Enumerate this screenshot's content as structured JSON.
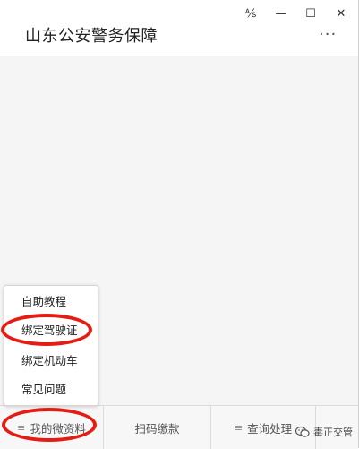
{
  "window": {
    "title": "山东公安警务保障",
    "controls": {
      "pin": "⅍",
      "minimize": "—",
      "maximize": "☐",
      "close": "✕"
    },
    "more": "···"
  },
  "popup_menu": {
    "items": [
      "自助教程",
      "绑定驾驶证",
      "绑定机动车",
      "常见问题"
    ]
  },
  "menu_bar": {
    "tabs": [
      {
        "label": "我的微资料",
        "has_menu": true
      },
      {
        "label": "扫码缴款",
        "has_menu": false
      },
      {
        "label": "查询处理",
        "has_menu": true
      }
    ],
    "menu_icon": "≡"
  },
  "watermark": {
    "text": "毒正交管"
  },
  "annotation_color": "#e41c14"
}
